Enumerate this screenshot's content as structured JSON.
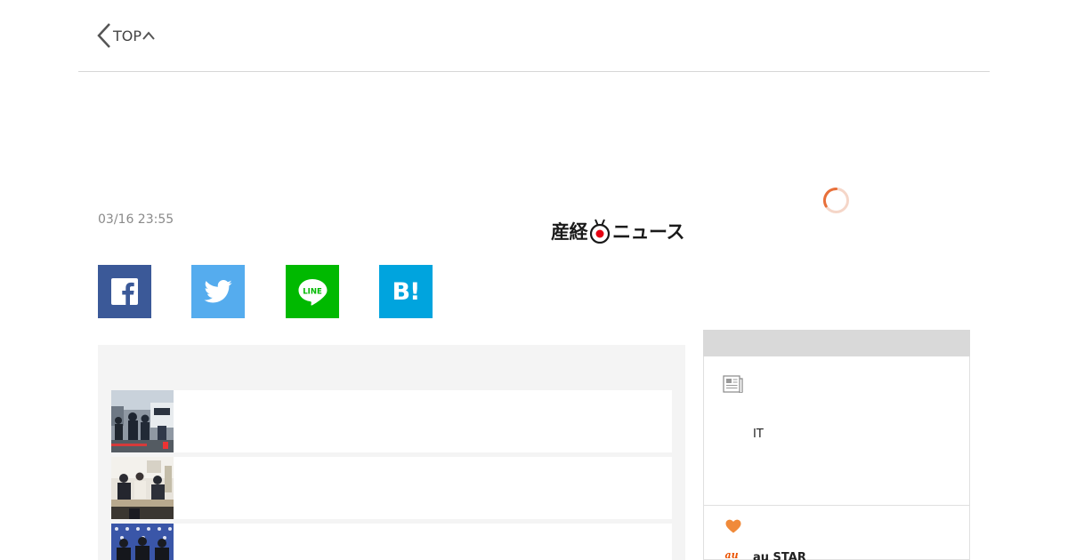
{
  "nav": {
    "back_label": "TOP"
  },
  "article": {
    "date": "03/16 23:55",
    "source": {
      "name_left": "産経",
      "name_right": "ニュース"
    }
  },
  "share": {
    "facebook": {
      "icon": "facebook-icon",
      "color": "#3b5998"
    },
    "twitter": {
      "icon": "twitter-icon",
      "color": "#55acee"
    },
    "line": {
      "icon": "line-icon",
      "label": "LINE",
      "color": "#00b900"
    },
    "hatena": {
      "icon": "hatena-bookmark-icon",
      "label": "B!",
      "color": "#00a4de"
    }
  },
  "related": {
    "items": [
      {
        "thumb": "police-scene-photo"
      },
      {
        "thumb": "office-meeting-photo"
      },
      {
        "thumb": "press-conference-photo"
      }
    ]
  },
  "sidebar": {
    "category_label": "IT",
    "star_brand": "au STAR",
    "star_logo_text": "au",
    "accent_color": "#f08300"
  }
}
